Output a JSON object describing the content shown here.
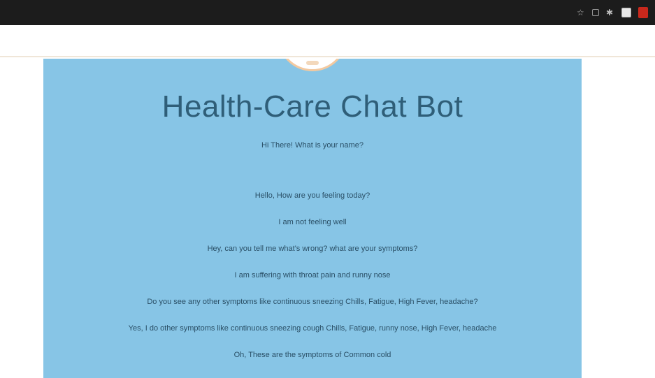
{
  "browser": {
    "url_prefix": "",
    "url": "",
    "icons": [
      "star-icon",
      "extension-icon",
      "puzzle-icon",
      "profile-icon",
      "menu-icon"
    ]
  },
  "header": {
    "welcome": "",
    "logout": ""
  },
  "chat": {
    "title": "Health-Care Chat Bot",
    "messages": [
      "Hi There! What is your name?",
      "",
      "Hello, How are you feeling today?",
      "I am not feeling well",
      "Hey, can you tell me what's wrong? what are your symptoms?",
      "I am suffering with throat pain and runny nose",
      "Do you see any other symptoms like continuous sneezing Chills, Fatigue, High Fever, headache?",
      "Yes, I do other symptoms like continuous sneezing cough Chills, Fatigue, runny nose, High Fever, headache",
      "Oh, These are the symptoms of Common cold"
    ]
  },
  "colors": {
    "panel": "#87c5e6",
    "title": "#2f5e78",
    "browser_bar": "#1c1c1c"
  }
}
